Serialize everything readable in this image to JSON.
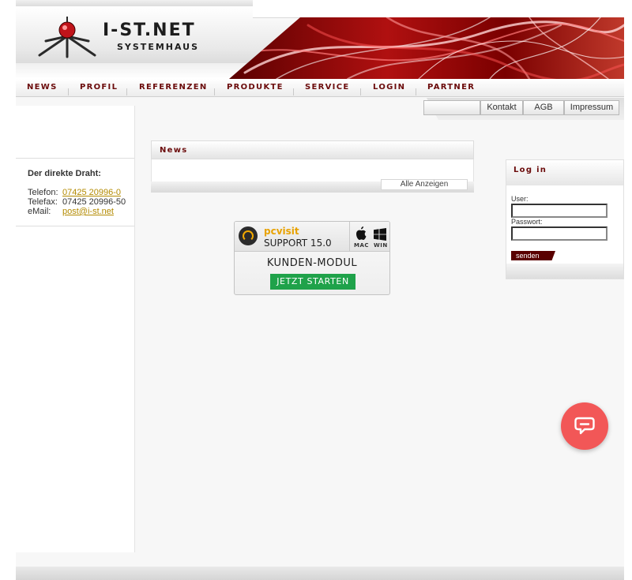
{
  "brand": {
    "title": "I-ST.NET",
    "subtitle": "SYSTEMHAUS"
  },
  "nav": {
    "items": [
      "News",
      "Profil",
      "Referenzen",
      "Produkte",
      "Service",
      "Login",
      "Partner"
    ]
  },
  "subnav": {
    "items": [
      "Kontakt",
      "AGB",
      "Impressum"
    ]
  },
  "contact": {
    "title": "Der direkte Draht:",
    "phone_label": "Telefon:",
    "phone": "07425 20996-0",
    "fax_label": "Telefax:",
    "fax": "07425 20996-50",
    "email_label": "eMail:",
    "email": "post@i-st.net"
  },
  "news": {
    "title": "News",
    "all_label": "Alle Anzeigen"
  },
  "pcvisit": {
    "brand": "pcvisit",
    "version": "SUPPORT 15.0",
    "mac": "MAC",
    "win": "WIN",
    "module": "KUNDEN-MODUL",
    "start": "JETZT STARTEN"
  },
  "login": {
    "title": "Log in",
    "user_label": "User:",
    "password_label": "Passwort:",
    "submit": "senden"
  },
  "colors": {
    "nav_text": "#6b0b0b",
    "link": "#b38a00",
    "chat_button": "#f25757",
    "start_button": "#1fa24a"
  },
  "icons": [
    "logo-bug-icon",
    "apple-icon",
    "windows-icon",
    "chat-icon"
  ]
}
